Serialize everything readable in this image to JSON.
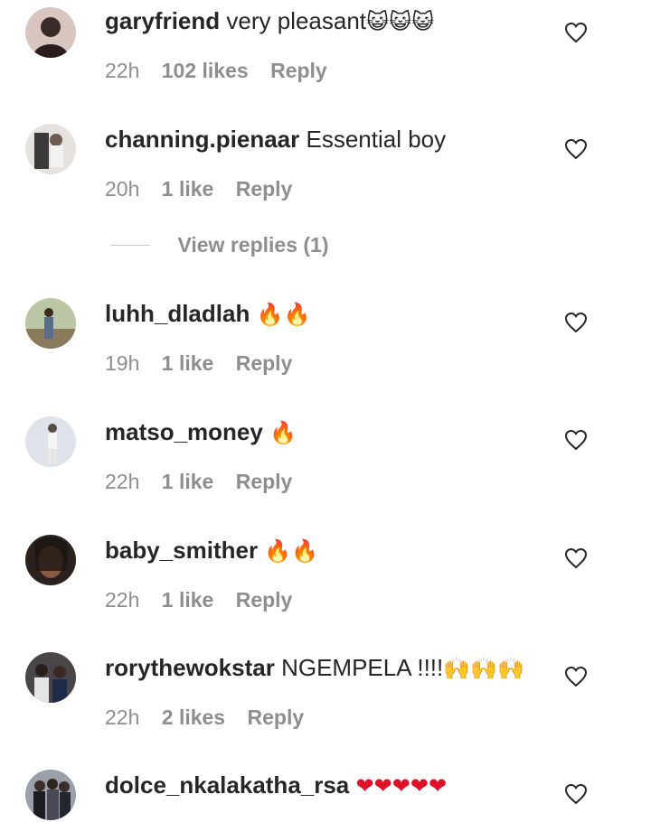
{
  "comments": [
    {
      "username": "garyfriend",
      "text": "very pleasant",
      "emoji": "😺😺😺",
      "time": "22h",
      "likes": "102 likes",
      "reply": "Reply",
      "avatar_color": "#3a2a28"
    },
    {
      "username": "channing.pienaar",
      "text": "Essential boy",
      "emoji": "",
      "time": "20h",
      "likes": "1 like",
      "reply": "Reply",
      "avatar_color": "#8a8a88"
    },
    {
      "username": "luhh_dladlah",
      "text": "",
      "emoji": "🔥🔥",
      "time": "19h",
      "likes": "1 like",
      "reply": "Reply",
      "avatar_color": "#7a8c5a"
    },
    {
      "username": "matso_money",
      "text": "",
      "emoji": "🔥",
      "time": "22h",
      "likes": "1 like",
      "reply": "Reply",
      "avatar_color": "#c9ccd3"
    },
    {
      "username": "baby_smither",
      "text": "",
      "emoji": "🔥🔥",
      "time": "22h",
      "likes": "1 like",
      "reply": "Reply",
      "avatar_color": "#4a3a30"
    },
    {
      "username": "rorythewokstar",
      "text": "NGEMPELA !!!!",
      "emoji": "🙌🙌🙌",
      "time": "22h",
      "likes": "2 likes",
      "reply": "Reply",
      "avatar_color": "#3c3030"
    },
    {
      "username": "dolce_nkalakatha_rsa",
      "text": "",
      "emoji": "❤❤❤❤❤",
      "time": "",
      "likes": "",
      "reply": "",
      "avatar_color": "#6a6f78"
    }
  ],
  "view_replies": "View replies (1)",
  "colors": {
    "meta": "#8e8e8e",
    "text": "#262626",
    "heart_outline": "#262626",
    "fire": "#f4511e",
    "heart_red": "#e0102a"
  }
}
